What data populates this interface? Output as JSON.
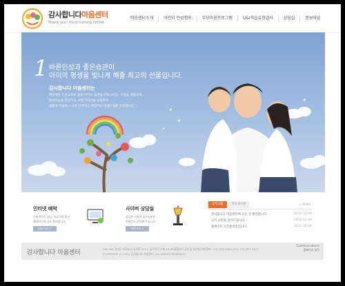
{
  "header": {
    "title_a": "감사합니다",
    "title_b": "마음센터",
    "subtitle": "Thank you!     mind training center",
    "nav": [
      "마음센터소개",
      "어린이 인성캠프",
      "부모마음프로그램",
      "U&I학습유형검사",
      "상담실",
      "정보마당"
    ]
  },
  "hero": {
    "number": "1",
    "headline_1": "바른인성과 좋은습관이",
    "headline_2": "아이의 평생을 빛나게 해줄 최고의 선물입니다.",
    "intro_title": "감사합니다 마음센터는",
    "intro_lines": [
      "매일매일 인성교육을 통해 아이의 습관을 변화시키고, 기질을 계발하여,",
      "정서지능을 향상하고, 바른가치관을 길들여서",
      "생활과 학습을 스스로 선택하고 책임지는 미래인재를 양성합니다."
    ]
  },
  "panels": {
    "internet": {
      "title": "인터넷 예약",
      "lines": [
        "인터넷으로 상담, 프로그램 참가",
        "예약하시면 신속 편리합니다."
      ],
      "button": "바로가기 >"
    },
    "cyber": {
      "title": "사이버 상담실",
      "lines": [
        "궁금한 사항이 있으신분은",
        "언제든지 문의해 주십시오."
      ],
      "button": "바로가기 >"
    }
  },
  "notice": {
    "tabs": [
      "공지사항",
      "자유게시판"
    ],
    "more": "+ MORE",
    "items": [
      {
        "title": "감사합니다 마음센터에 오신 걸 환영합니다.",
        "date": "2012-10-09"
      },
      {
        "title": "공지 사항을 알려드립니다.",
        "date": "2012-10-09"
      },
      {
        "title": "홈페이지 오픈준비중입니다.",
        "date": "2012-10-09"
      }
    ]
  },
  "footer": {
    "name": "감사합니다 마음센터",
    "address_1": "480-060 경기도 의정부시 금오동 472-1 금오아이 스퀘 401호(홍플러스 금오점 맞은편)대표전화 : 031-853-3866 |FAX: 031-853-3877",
    "address_2": "COPYRIGHT (C) 2012 감사합니다 마음센터, ALL RIGHTS RESERVED",
    "brand_1": "Communications",
    "brand_2": "홈페이지 제작"
  }
}
